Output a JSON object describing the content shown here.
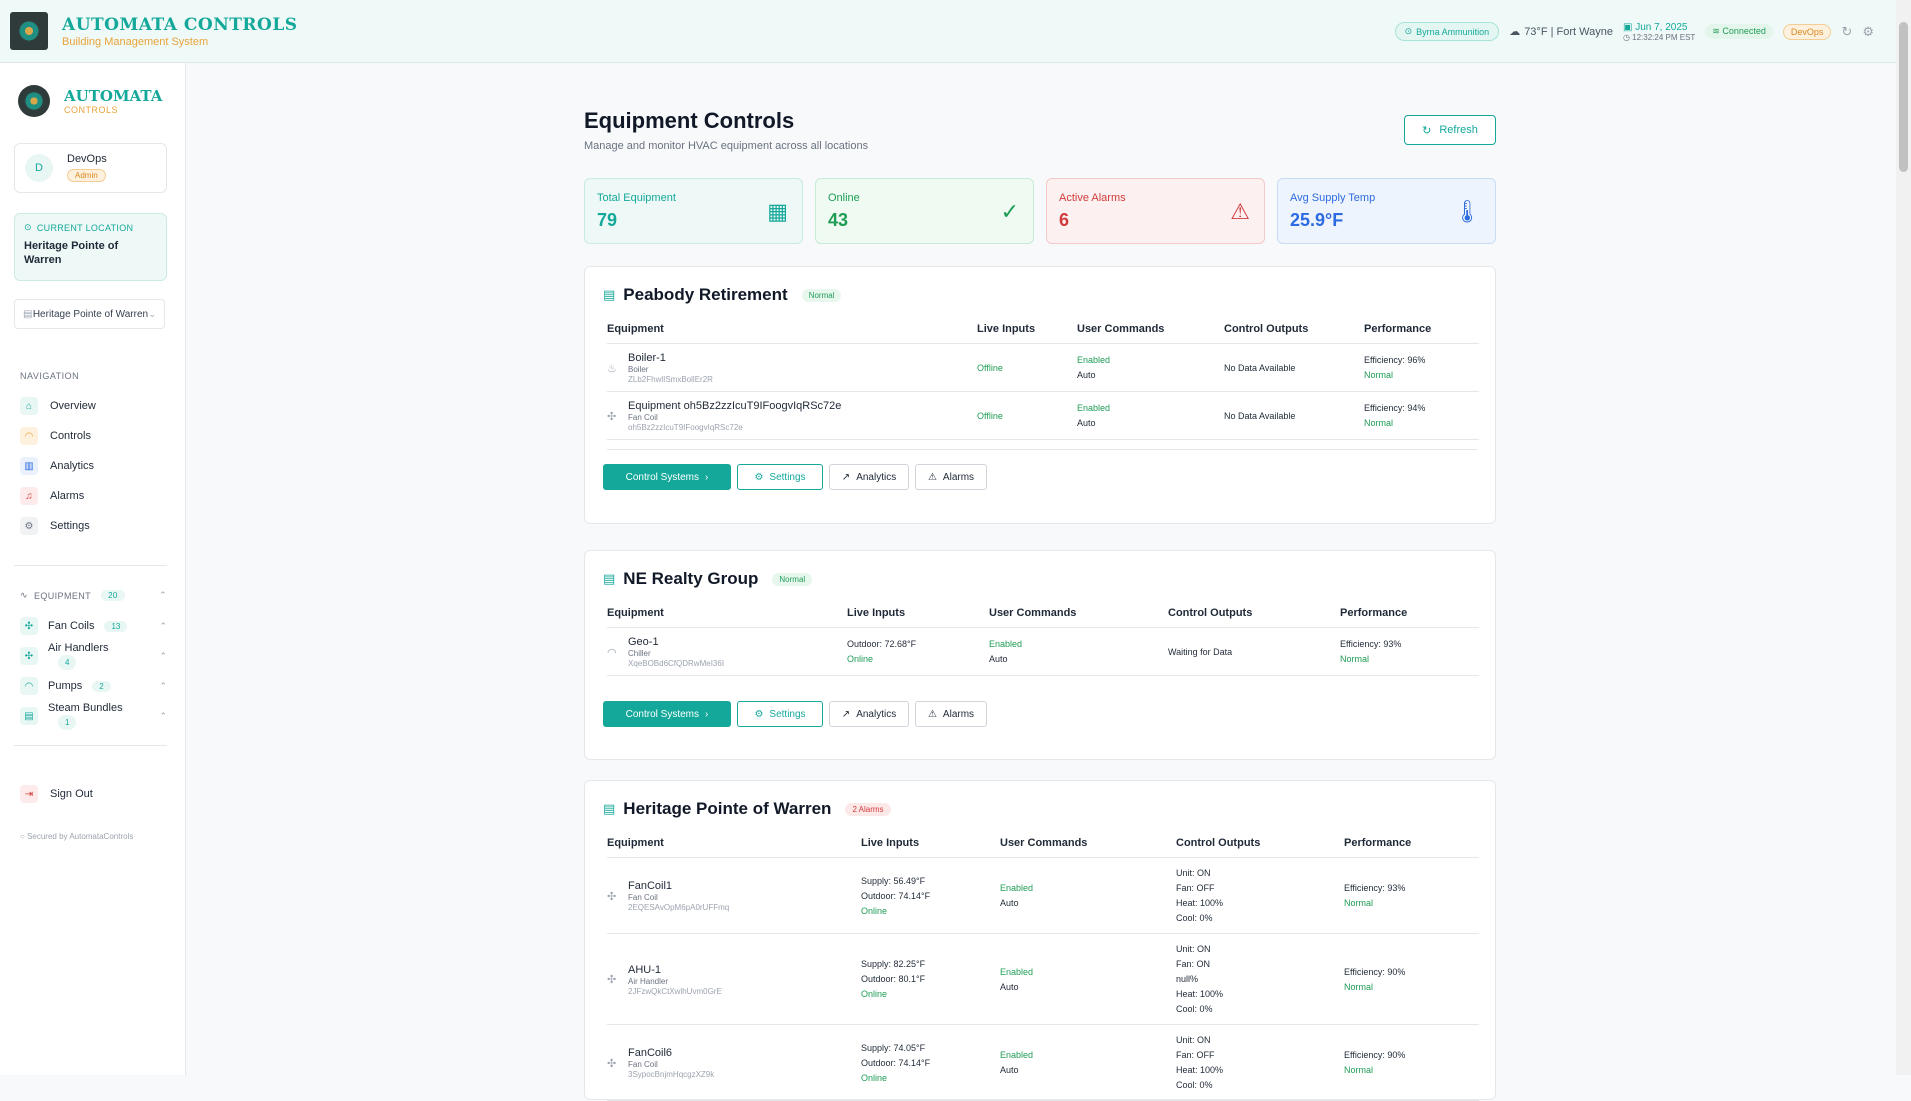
{
  "topbar": {
    "brand_title": "AUTOMATA CONTROLS",
    "brand_sub": "Building Management System",
    "location": "Byrna Ammunition",
    "weather": "73°F | Fort Wayne",
    "date": "Jun 7, 2025",
    "time": "12:32:24 PM EST",
    "connection": "Connected",
    "role": "DevOps"
  },
  "sidebar": {
    "brand_t1": "AUTOMATA",
    "brand_t2": "CONTROLS",
    "user_initial": "D",
    "user_name": "DevOps",
    "user_role": "Admin",
    "current_location_label": "CURRENT LOCATION",
    "current_location": "Heritage Pointe of Warren",
    "location_select": "Heritage Pointe of Warren",
    "nav_label": "NAVIGATION",
    "nav": [
      {
        "label": "Overview"
      },
      {
        "label": "Controls"
      },
      {
        "label": "Analytics"
      },
      {
        "label": "Alarms"
      },
      {
        "label": "Settings"
      }
    ],
    "equipment_label": "EQUIPMENT",
    "equipment_count": "20",
    "equipment": [
      {
        "label": "Fan Coils",
        "count": "13"
      },
      {
        "label": "Air Handlers",
        "count": "4"
      },
      {
        "label": "Pumps",
        "count": "2"
      },
      {
        "label": "Steam Bundles",
        "count": "1"
      }
    ],
    "signout": "Sign Out",
    "secured": "Secured by AutomataControls"
  },
  "main": {
    "title": "Equipment Controls",
    "subtitle": "Manage and monitor HVAC equipment across all locations",
    "refresh": "Refresh",
    "stats": [
      {
        "label": "Total Equipment",
        "value": "79"
      },
      {
        "label": "Online",
        "value": "43"
      },
      {
        "label": "Active Alarms",
        "value": "6"
      },
      {
        "label": "Avg Supply Temp",
        "value": "25.9°F"
      }
    ],
    "headers": [
      "Equipment",
      "Live Inputs",
      "User Commands",
      "Control Outputs",
      "Performance"
    ],
    "buttons": {
      "control": "Control Systems",
      "settings": "Settings",
      "analytics": "Analytics",
      "alarms": "Alarms"
    },
    "locations": [
      {
        "name": "Peabody Retirement",
        "badge": "Normal",
        "rows": [
          {
            "name": "Boiler-1",
            "type": "Boiler",
            "id": "ZLb2FhwlISmxBollEr2R",
            "inputs": [
              "Offline"
            ],
            "cmd1": "Enabled",
            "cmd2": "Auto",
            "outputs": [
              "No Data Available"
            ],
            "eff": "Efficiency: 96%",
            "status": "Normal"
          },
          {
            "name": "Equipment oh5Bz2zzIcuT9IFoogvIqRSc72e",
            "type": "Fan Coil",
            "id": "oh5Bz2zzIcuT9IFoogvIqRSc72e",
            "inputs": [
              "Offline"
            ],
            "cmd1": "Enabled",
            "cmd2": "Auto",
            "outputs": [
              "No Data Available"
            ],
            "eff": "Efficiency: 94%",
            "status": "Normal"
          }
        ]
      },
      {
        "name": "NE Realty Group",
        "badge": "Normal",
        "rows": [
          {
            "name": "Geo-1",
            "type": "Chiller",
            "id": "XqeBOBd6CfQDRwMeI36I",
            "inputs": [
              "Outdoor: 72.68°F",
              "Online"
            ],
            "cmd1": "Enabled",
            "cmd2": "Auto",
            "outputs": [
              "Waiting for Data"
            ],
            "eff": "Efficiency: 93%",
            "status": "Normal"
          }
        ]
      },
      {
        "name": "Heritage Pointe of Warren",
        "badge": "2 Alarms",
        "rows": [
          {
            "name": "FanCoil1",
            "type": "Fan Coil",
            "id": "2EQESAvOpM6pA0rUFFmq",
            "inputs": [
              "Supply: 56.49°F",
              "Outdoor: 74.14°F",
              "Online"
            ],
            "cmd1": "Enabled",
            "cmd2": "Auto",
            "outputs": [
              "Unit: ON",
              "Fan: OFF",
              "Heat: 100%",
              "Cool: 0%"
            ],
            "eff": "Efficiency: 93%",
            "status": "Normal"
          },
          {
            "name": "AHU-1",
            "type": "Air Handler",
            "id": "2JFzwQkCtXwlhUvm0GrE",
            "inputs": [
              "Supply: 82.25°F",
              "Outdoor: 80.1°F",
              "Online"
            ],
            "cmd1": "Enabled",
            "cmd2": "Auto",
            "outputs": [
              "Unit: ON",
              "Fan: ON",
              "null%",
              "Heat: 100%",
              "Cool: 0%"
            ],
            "eff": "Efficiency: 90%",
            "status": "Normal"
          },
          {
            "name": "FanCoil6",
            "type": "Fan Coil",
            "id": "3SypocBnjmHqcgzXZ9k",
            "inputs": [
              "Supply: 74.05°F",
              "Outdoor: 74.14°F",
              "Online"
            ],
            "cmd1": "Enabled",
            "cmd2": "Auto",
            "outputs": [
              "Unit: ON",
              "Fan: OFF",
              "Heat: 100%",
              "Cool: 0%"
            ],
            "eff": "Efficiency: 90%",
            "status": "Normal"
          }
        ]
      }
    ]
  }
}
